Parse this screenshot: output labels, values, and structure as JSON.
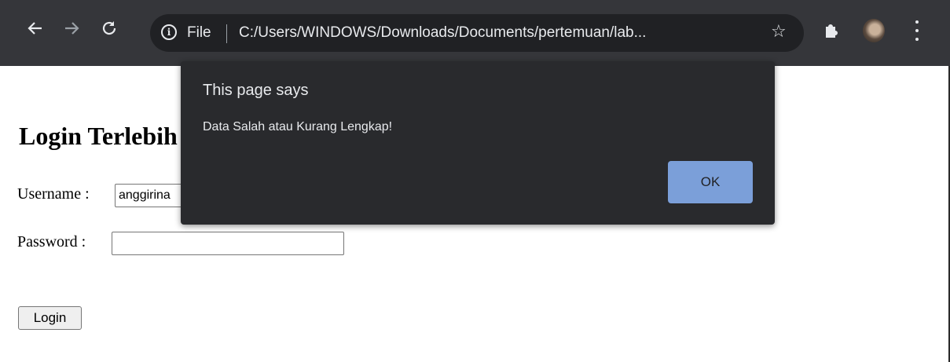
{
  "browser": {
    "scheme": "File",
    "url": "C:/Users/WINDOWS/Downloads/Documents/pertemuan/lab...",
    "icons": [
      "back-arrow-icon",
      "forward-arrow-icon",
      "reload-icon",
      "info-icon",
      "star-icon",
      "extensions-icon",
      "avatar",
      "menu-icon"
    ]
  },
  "page": {
    "title": "Login Terlebih Dahulu",
    "username_label": "Username :",
    "username_value": "anggirina",
    "password_label": "Password :",
    "password_value": "",
    "login_label": "Login"
  },
  "dialog": {
    "title": "This page says",
    "message": "Data Salah atau Kurang Lengkap!",
    "ok_label": "OK"
  },
  "colors": {
    "toolbar": "#35363a",
    "omnibox": "#202124",
    "dialog_bg": "#292a2d",
    "ok_button": "#8ab4f8"
  }
}
